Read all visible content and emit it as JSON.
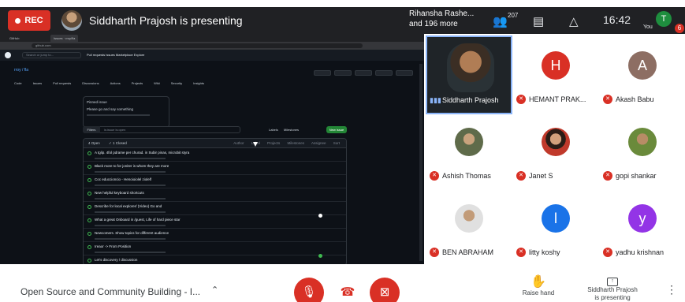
{
  "topbar": {
    "rec_label": "REC",
    "presenting_text": "Siddharth Prajosh is presenting",
    "viewers_line1": "Rihansha Rashe...",
    "viewers_line2": "and 196 more",
    "participants_count": "207",
    "clock": "16:42",
    "you_initial": "T",
    "you_label": "You",
    "notification_count": "6"
  },
  "screen": {
    "tabs": [
      "GitHub",
      "Issues · rroy/fla"
    ],
    "url": "github.com",
    "search_placeholder": "Search or jump to...",
    "nav": "Pull requests   Issues   Marketplace   Explore",
    "repo": "rroy / fla",
    "repo_tabs": [
      "Code",
      "Issues",
      "Pull requests",
      "Discussions",
      "Actions",
      "Projects",
      "Wiki",
      "Security",
      "Insights"
    ],
    "pinned_label": "Pinned issue",
    "pinned_title": "Please go and say something",
    "filter_label": "Filters",
    "filter_placeholder": "is:issue is:open",
    "filter_links": "Labels  Milestones",
    "new_issue": "New issue",
    "issues_open": "4 Open",
    "issues_closed": "✓ 1 Closed",
    "issues_head_right": "Author  Label  Projects  Milestones  Assignee  Sort",
    "issues": [
      "A tglip. 4fol pdrame per churad. in Subir pinas, microbit styra",
      "Black more to for joniter is whom they are more",
      "Coc educcioncio - Henoioiolel ziolelf",
      "New helpful keyboard shortcuts",
      "Describe for local explorer/ (Video) Go and",
      "What a great Onboard in /guest, Life of hard piece star",
      "Newcomers. Show topics for different audience",
      "Ireaor -> From Position",
      "Let's discovery / discussion"
    ]
  },
  "participants": [
    {
      "name": "Siddharth Prajosh",
      "type": "speaker"
    },
    {
      "name": "HEMANT PRAK...",
      "initial": "H",
      "color": "#d93025"
    },
    {
      "name": "Akash Babu",
      "initial": "A",
      "color": "#8d6e63"
    },
    {
      "name": "Ashish Thomas",
      "type": "photo",
      "color": "#5f6b4a"
    },
    {
      "name": "Janet S",
      "type": "photo",
      "color": "#c0392b"
    },
    {
      "name": "gopi shankar",
      "type": "photo",
      "color": "#6a8a3b"
    },
    {
      "name": "BEN ABRAHAM",
      "type": "photo",
      "color": "#9e9e9e"
    },
    {
      "name": "litty koshy",
      "initial": "l",
      "color": "#1a73e8"
    },
    {
      "name": "yadhu krishnan",
      "initial": "y",
      "color": "#9334e6"
    }
  ],
  "bottombar": {
    "meeting_title": "Open Source and Community Building - I...",
    "raise_hand": "Raise hand",
    "present_line1": "Siddharth Prajosh",
    "present_line2": "is presenting"
  },
  "icons": {
    "mic": "mic-off-icon",
    "end": "call-end-icon",
    "cam": "videocam-off-icon",
    "people": "people-icon",
    "chat": "chat-icon",
    "activities": "activities-icon",
    "raise": "hand-icon",
    "present": "present-to-all-icon",
    "more": "more-vert-icon"
  }
}
